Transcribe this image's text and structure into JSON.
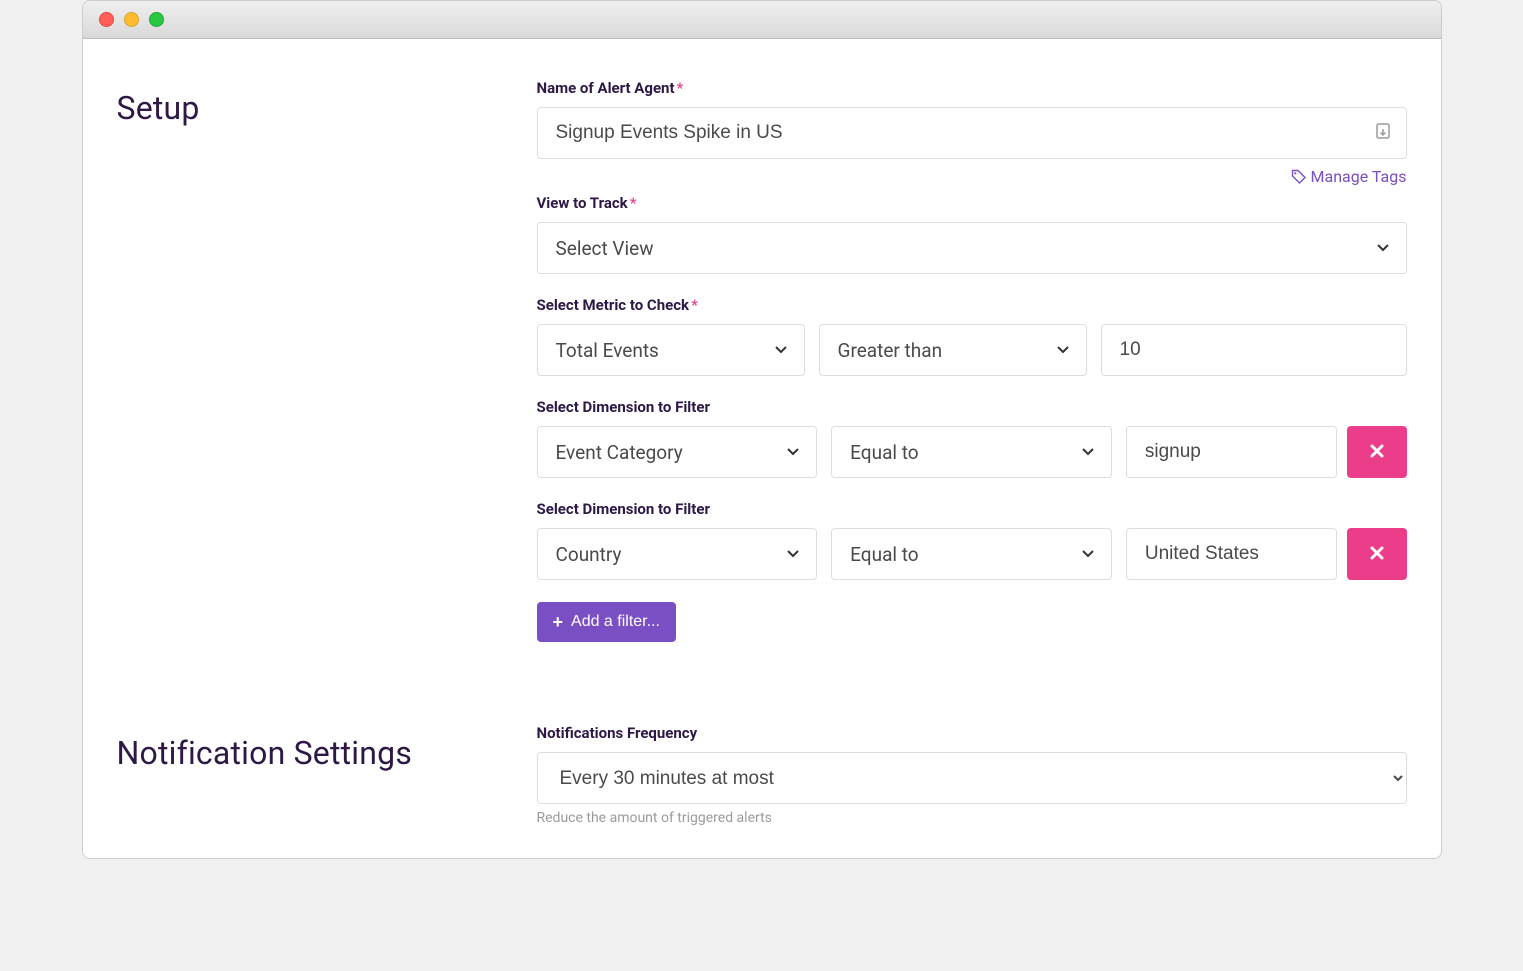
{
  "sections": {
    "setup_title": "Setup",
    "notification_title": "Notification Settings"
  },
  "labels": {
    "name": "Name of Alert Agent",
    "view": "View to Track",
    "metric": "Select Metric to Check",
    "dimension": "Select Dimension to Filter",
    "notif_freq": "Notifications Frequency"
  },
  "setup": {
    "name_value": "Signup Events Spike in US",
    "manage_tags": "Manage Tags",
    "view_selected": "Select View",
    "metric": {
      "metric_selected": "Total Events",
      "operator_selected": "Greater than",
      "value": "10"
    },
    "filters": [
      {
        "dimension": "Event Category",
        "operator": "Equal to",
        "value": "signup"
      },
      {
        "dimension": "Country",
        "operator": "Equal to",
        "value": "United States"
      }
    ],
    "add_filter_label": "Add a filter..."
  },
  "notifications": {
    "frequency_selected": "Every 30 minutes at most",
    "helper": "Reduce the amount of triggered alerts"
  }
}
